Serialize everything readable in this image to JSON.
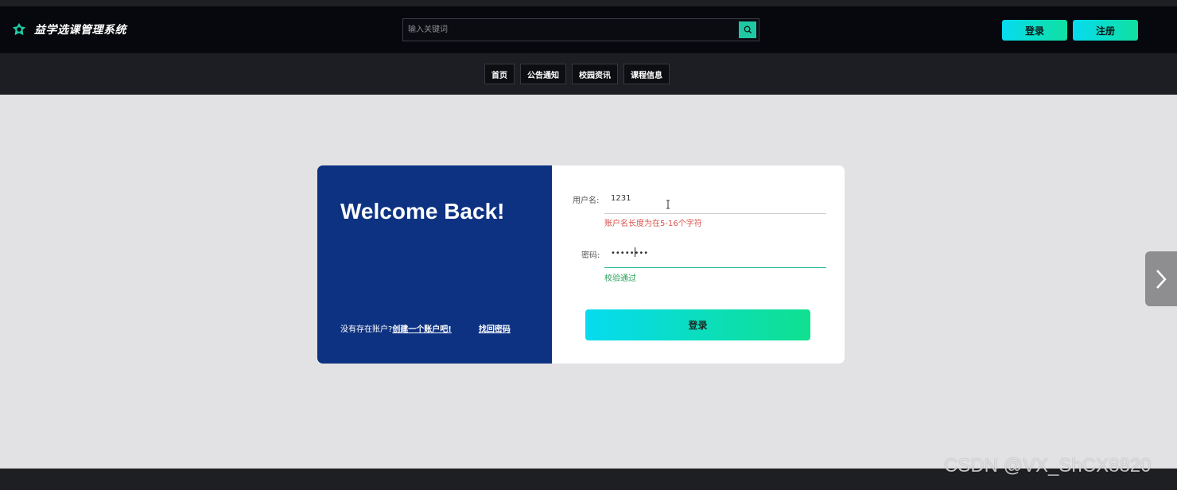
{
  "header": {
    "app_title": "益学选课管理系统",
    "search": {
      "placeholder": "输入关键词",
      "value": ""
    },
    "login_label": "登录",
    "register_label": "注册"
  },
  "nav": {
    "items": [
      {
        "label": "首页"
      },
      {
        "label": "公告通知"
      },
      {
        "label": "校园资讯"
      },
      {
        "label": "课程信息"
      }
    ]
  },
  "login_card": {
    "welcome_title": "Welcome Back!",
    "no_account_text": "没有存在账户?",
    "create_account_link": "创建一个账户吧!",
    "forgot_password_link": "找回密码",
    "username": {
      "label": "用户名:",
      "value": "1231",
      "error": "账户名长度为在5-16个字符"
    },
    "password": {
      "label": "密码:",
      "value": "••••••••",
      "success": "校验通过"
    },
    "submit_label": "登录"
  },
  "colors": {
    "accent": "#1fc8a2",
    "card_left_bg": "#0d3282",
    "error": "#d9534f",
    "success": "#2aa056"
  },
  "watermark": "CSDN @VX_ShCX8820"
}
